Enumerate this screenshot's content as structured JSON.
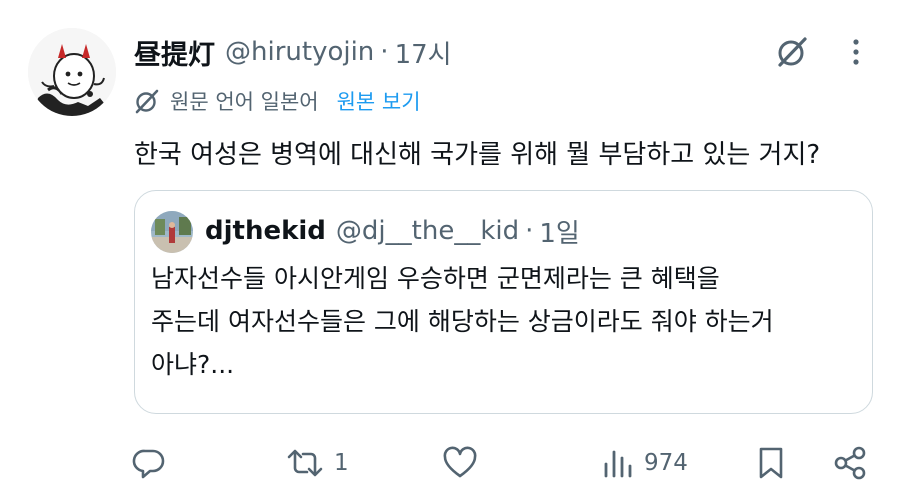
{
  "tweet": {
    "author": {
      "display_name": "昼提灯",
      "handle": "@hirutyojin",
      "time": "17시"
    },
    "separator": "·",
    "translation": {
      "language_label": "원문 언어 일본어",
      "show_original": "원본 보기"
    },
    "text": "한국 여성은 병역에 대신해 국가를 위해 뭘 부담하고 있는 거지?"
  },
  "quote": {
    "display_name": "djthekid",
    "handle": "@dj__the__kid",
    "time": "1일",
    "lines": [
      "남자선수들 아시안게임 우승하면 군면제라는 큰 혜택을",
      "주는데 여자선수들은 그에 해당하는 상금이라도 줘야 하는거",
      "아냐?..."
    ]
  },
  "actions": {
    "reply": {
      "icon": "reply-icon"
    },
    "retweet": {
      "icon": "retweet-icon",
      "count": "1"
    },
    "like": {
      "icon": "like-icon"
    },
    "views": {
      "icon": "views-icon",
      "count": "974"
    },
    "bookmark": {
      "icon": "bookmark-icon"
    },
    "share": {
      "icon": "share-icon"
    }
  },
  "colors": {
    "text": "#0f1419",
    "secondary": "#536471",
    "link": "#1d9bf0",
    "border": "#cfd9de"
  }
}
